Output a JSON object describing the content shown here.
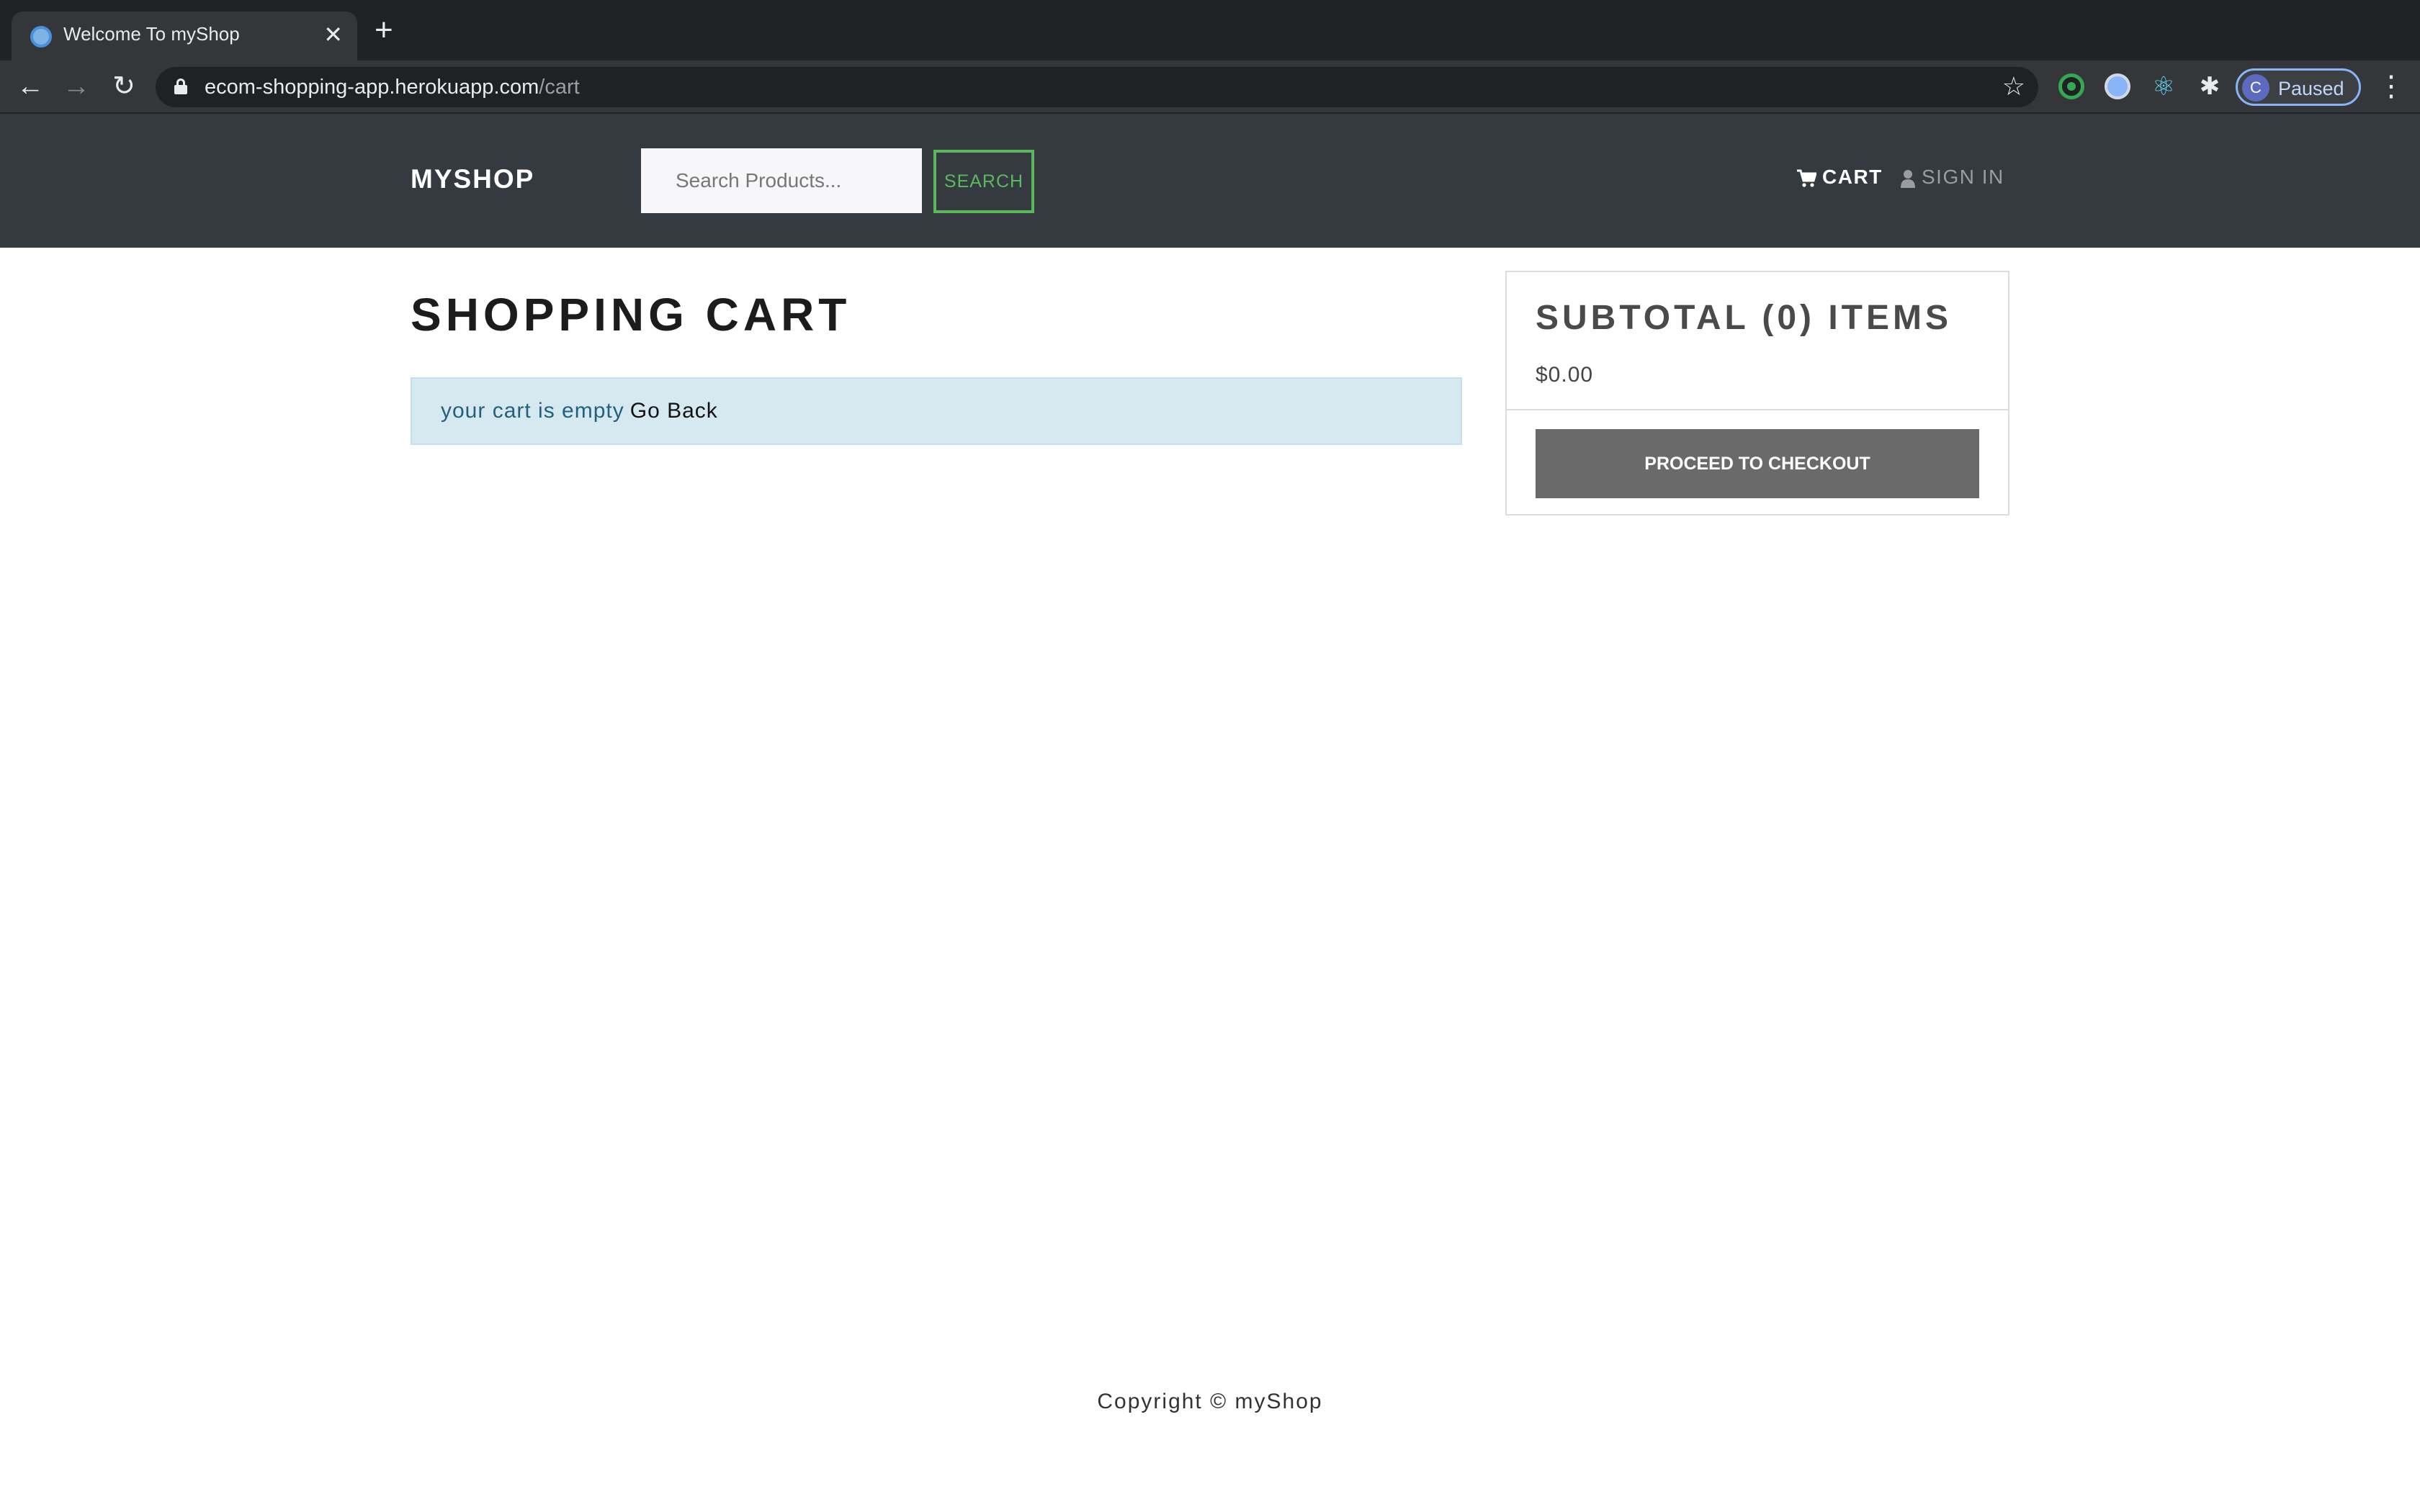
{
  "browser": {
    "tab_title": "Welcome To myShop",
    "tab_close": "✕",
    "new_tab": "+",
    "url_host": "ecom-shopping-app.herokuapp.com",
    "url_path": "/cart",
    "profile_initial": "C",
    "profile_status": "Paused"
  },
  "navbar": {
    "brand": "MYSHOP",
    "search_placeholder": "Search Products...",
    "search_button": "SEARCH",
    "cart_label": "CART",
    "signin_label": "SIGN IN"
  },
  "cart": {
    "title": "SHOPPING CART",
    "empty_message": "your cart is empty",
    "go_back": "Go Back"
  },
  "summary": {
    "title": "SUBTOTAL (0) ITEMS",
    "amount": "$0.00",
    "checkout_button": "PROCEED TO CHECKOUT"
  },
  "footer": {
    "copyright": "Copyright © myShop"
  },
  "colors": {
    "navbar_bg": "#343a40",
    "search_accent": "#5cb85c",
    "alert_bg": "#d6e9f1",
    "checkout_bg": "#6a6a6a"
  }
}
